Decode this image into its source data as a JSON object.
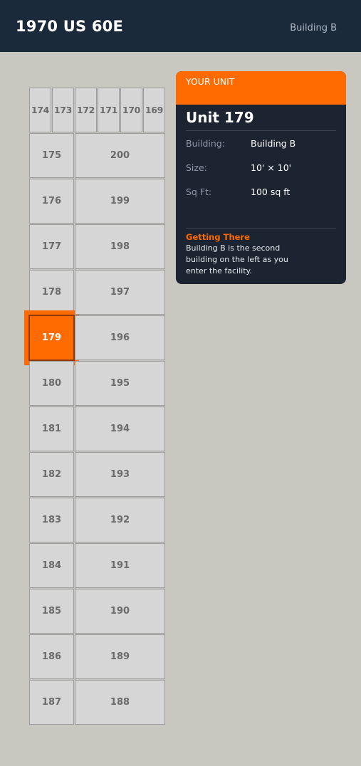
{
  "header": {
    "title": "1970 US 60E",
    "building": "Building B"
  },
  "map": {
    "selected_unit": "179",
    "top_row": [
      "174",
      "173",
      "172",
      "171",
      "170",
      "169"
    ],
    "left_column": [
      "175",
      "176",
      "177",
      "178",
      "179",
      "180",
      "181",
      "182",
      "183",
      "184",
      "185",
      "186",
      "187"
    ],
    "right_column": [
      "200",
      "199",
      "198",
      "197",
      "196",
      "195",
      "194",
      "193",
      "192",
      "191",
      "190",
      "189",
      "188"
    ]
  },
  "panel": {
    "header_label": "YOUR UNIT",
    "unit_title": "Unit 179",
    "fields": [
      {
        "label": "Building:",
        "value": "Building B"
      },
      {
        "label": "Size:",
        "value": "10' × 10'"
      },
      {
        "label": "Sq Ft:",
        "value": "100 sq ft"
      }
    ],
    "getting_there_title": "Getting There",
    "getting_there_text": "Building B is the second building on the left as you enter the facility."
  },
  "colors": {
    "accent": "#ff6b00",
    "header_bg": "#1b2a3b",
    "panel_bg": "#1b2430",
    "page_bg": "#c8c8c0"
  }
}
